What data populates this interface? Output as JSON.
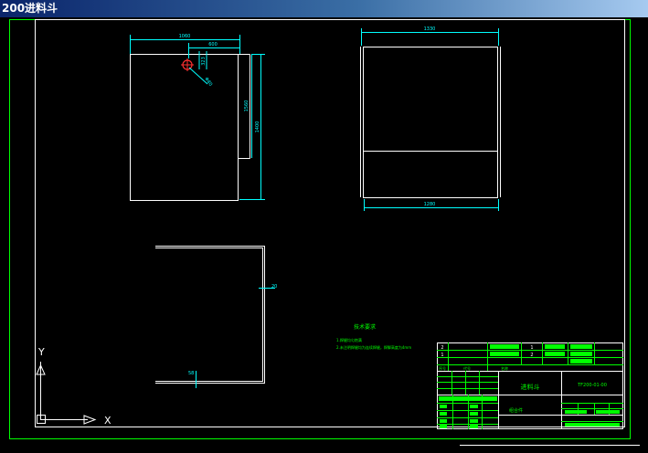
{
  "window": {
    "title": "200进料斗"
  },
  "drawing": {
    "front_view": {
      "dim_total_width": "1060",
      "dim_hole_offset": "600",
      "dim_hole_small": "323",
      "dim_hole_diameter": "Φ80",
      "dim_right_inner": "1560",
      "dim_right_outer": "1400"
    },
    "side_view": {
      "dim_top": "1330",
      "dim_bottom": "1280"
    },
    "section_view": {
      "dim_right": "20",
      "dim_bottom": "58"
    },
    "notes": {
      "heading": "技术要求",
      "line1": "1.焊缝均匀饱满",
      "line2": "2.未注明焊缝均为连续焊缝，焊脚高度为4mm"
    },
    "title_block": {
      "part_name": "进料斗",
      "drawing_no": "TF200-01-00",
      "material": "组合件",
      "row1_no": "2",
      "row2_no": "1",
      "row1_qty": "1",
      "row2_qty": "2",
      "header_seq": "序号",
      "header_code": "代号",
      "header_name": "名称"
    },
    "ucs": {
      "x_label": "X",
      "y_label": "Y"
    }
  },
  "colors": {
    "background": "#000000",
    "border": "#ffffff",
    "outer_frame": "#00ff00",
    "dimension": "#00ffff",
    "geometry": "#ffffff",
    "hole": "#ff3030",
    "notes": "#00ff00"
  }
}
